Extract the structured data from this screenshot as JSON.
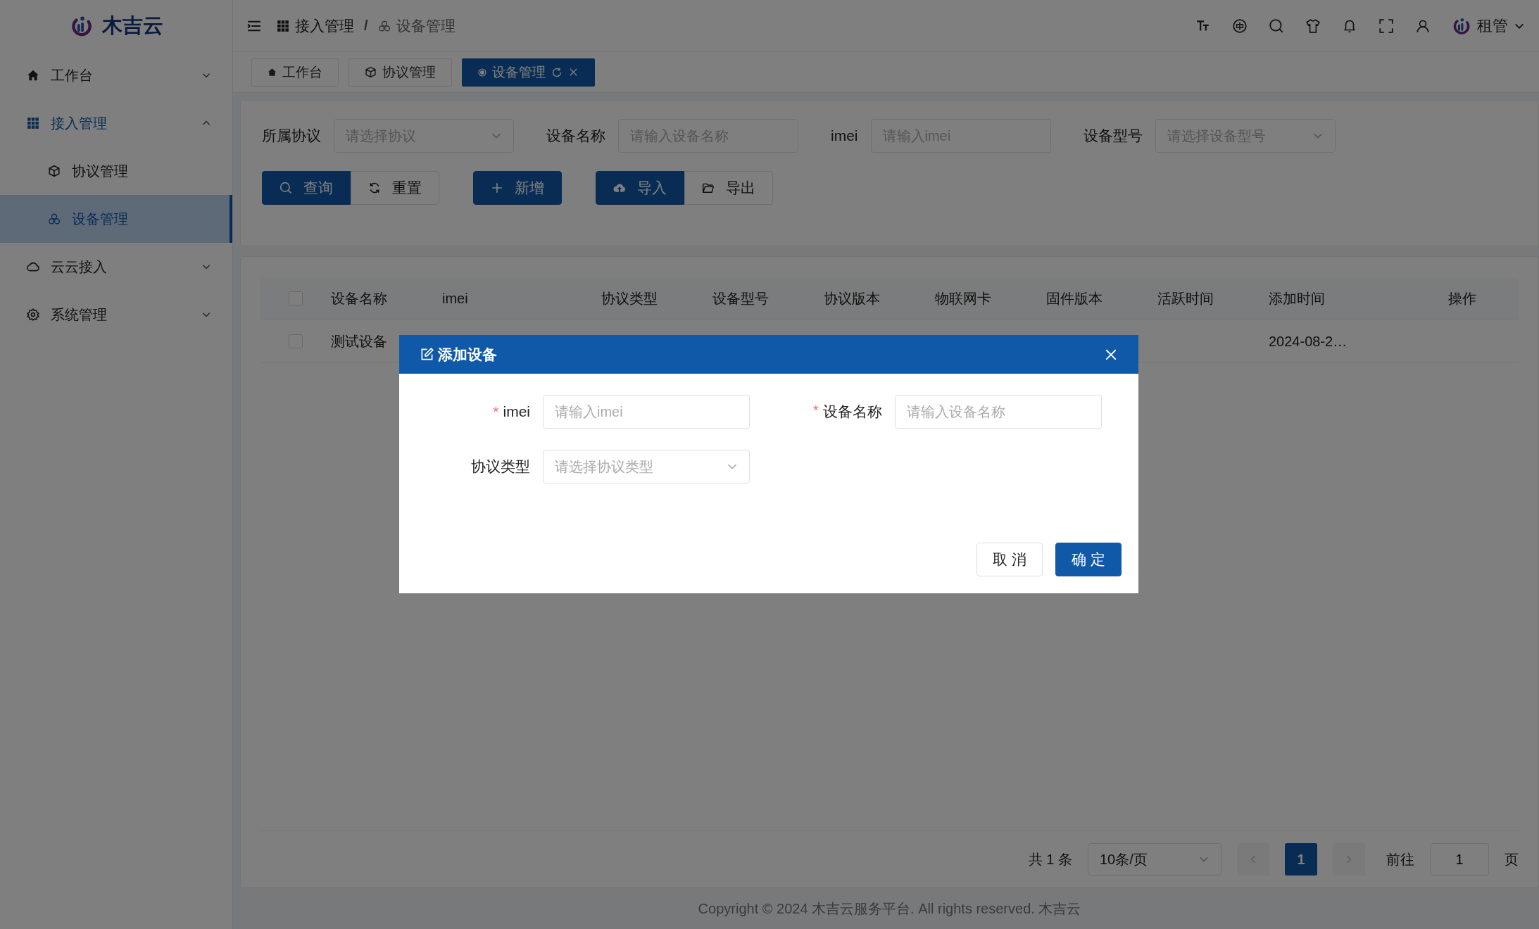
{
  "sidebar": {
    "logo_text": "木吉云",
    "items": [
      {
        "label": "工作台",
        "expanded": false,
        "selected": false
      },
      {
        "label": "接入管理",
        "expanded": true,
        "selected": false,
        "children": [
          {
            "label": "协议管理",
            "selected": false
          },
          {
            "label": "设备管理",
            "selected": true
          }
        ]
      },
      {
        "label": "云云接入",
        "expanded": false,
        "selected": false
      },
      {
        "label": "系统管理",
        "expanded": false,
        "selected": false
      }
    ]
  },
  "header": {
    "breadcrumb": [
      "接入管理",
      "设备管理"
    ],
    "breadcrumb_separator": "/",
    "user": "租管"
  },
  "tabs": [
    {
      "label": "工作台",
      "selected": false
    },
    {
      "label": "协议管理",
      "selected": false
    },
    {
      "label": "设备管理",
      "selected": true
    }
  ],
  "filters": [
    {
      "kind": "select",
      "label": "所属协议",
      "placeholder": "请选择协议"
    },
    {
      "kind": "input",
      "label": "设备名称",
      "placeholder": "请输入设备名称"
    },
    {
      "kind": "input",
      "label": "imei",
      "placeholder": "请输入imei"
    },
    {
      "kind": "select",
      "label": "设备型号",
      "placeholder": "请选择设备型号"
    }
  ],
  "toolbar": [
    [
      {
        "label": "查询",
        "primary": true
      },
      {
        "label": "重置",
        "primary": false
      }
    ],
    [
      {
        "label": "新增",
        "primary": true
      }
    ],
    [
      {
        "label": "导入",
        "primary": true
      },
      {
        "label": "导出",
        "primary": false
      }
    ]
  ],
  "table": {
    "header_checked": false,
    "columns": [
      "设备名称",
      "imei",
      "协议类型",
      "设备型号",
      "协议版本",
      "物联网卡",
      "固件版本",
      "活跃时间",
      "添加时间",
      "操作"
    ],
    "rows": [
      {
        "checked": false,
        "name": "测试设备",
        "added": "2024-08-2…"
      }
    ]
  },
  "pagination": {
    "total": "共 1 条",
    "page_size": "10条/页",
    "pages": [
      {
        "label": "1",
        "selected": true
      }
    ],
    "goto_label": "前往",
    "goto_value": "1",
    "goto_suffix": "页"
  },
  "footer": "Copyright © 2024 木吉云服务平台. All rights reserved. 木吉云",
  "dialog": {
    "title": "添加设备",
    "fields": [
      {
        "kind": "input",
        "label": "imei",
        "required_mark": "*",
        "placeholder": "请输入imei"
      },
      {
        "kind": "input",
        "label": "设备名称",
        "required_mark": "*",
        "placeholder": "请输入设备名称"
      },
      {
        "kind": "select",
        "label": "协议类型",
        "placeholder": "请选择协议类型"
      }
    ],
    "buttons": [
      {
        "label": "取 消",
        "primary": false
      },
      {
        "label": "确 定",
        "primary": true
      }
    ]
  }
}
